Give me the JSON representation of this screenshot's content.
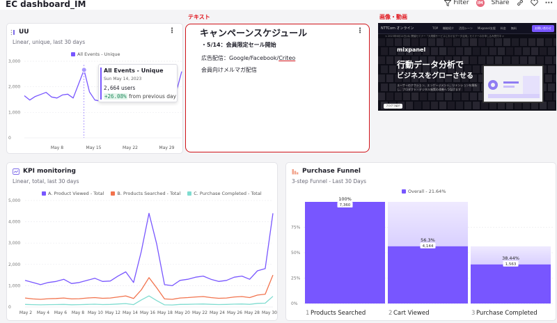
{
  "header": {
    "title": "EC dashboard_IM",
    "filter_label": "Filter",
    "avatar_initials": "IM",
    "share_label": "Share"
  },
  "annotations": {
    "text_label": "テキスト",
    "image_label": "画像・動画"
  },
  "uu_card": {
    "title": "UU",
    "subtitle": "Linear, unique, last 30 days",
    "legend": "All Events - Unique",
    "tooltip": {
      "title": "All Events - Unique",
      "date": "Sun May 14, 2023",
      "value": "2,664",
      "unit": "users",
      "change": "+26.08%",
      "change_suffix": "from previous day"
    }
  },
  "text_card": {
    "heading": "キャンペーンスケジュール",
    "line1": "・5/14：会員限定セール開始",
    "line2_prefix": "広告配信：Google/Facebook/",
    "line2_link": "Criteo",
    "line3": "会員向けメルマガ配信"
  },
  "banner": {
    "logo_text": "NTTCom オンライン",
    "nav_links": [
      "TOP",
      "機能紹介",
      "活用シーン",
      "Mixpanel支援",
      "料金",
      "無料"
    ],
    "cta": "お問い合わせ",
    "ticker": "< 2023年6月14日(水) 開催セミナー「大規模サービスにおけるデータ活用」セミナーのお申し込み受付中 >",
    "brand": "mixpanel",
    "headline1": "行動データ分析で",
    "headline2": "ビジネスをグローさせる",
    "body": "ユーザーのアクション、エンゲージメント、リテンションを解析し、プロダクト・デジタル施策の改善へつなげます",
    "chip": "ブログで紹介"
  },
  "kpi_card": {
    "title": "KPI monitoring",
    "subtitle": "Linear, total, last 30 days",
    "legend": [
      "A. Product Viewed - Total",
      "B. Products Searched - Total",
      "C. Purchase Completed - Total"
    ]
  },
  "funnel_card": {
    "title": "Purchase Funnel",
    "subtitle": "3-step Funnel - Last 30 Days",
    "legend": "Overall - 21.64%"
  },
  "chart_data": [
    {
      "type": "line",
      "title": "UU",
      "x_ticks": [
        "May 8",
        "May 15",
        "May 22",
        "May 29"
      ],
      "y_ticks": [
        "0",
        "1,000",
        "2,000",
        "3,000"
      ],
      "ylim": [
        0,
        3000
      ],
      "series": [
        {
          "name": "All Events - Unique",
          "color": "#7856ff",
          "values": [
            1650,
            1480,
            1620,
            1700,
            1780,
            1600,
            1560,
            1680,
            1710,
            1560,
            2112,
            2664,
            1800,
            1480,
            1440,
            1690,
            1620,
            1590,
            1600,
            1610,
            1580,
            1650,
            1620,
            1600,
            1620,
            1650,
            1560,
            1650,
            1800,
            2600
          ]
        }
      ]
    },
    {
      "type": "line",
      "title": "KPI monitoring",
      "x_ticks": [
        "May 2",
        "May 4",
        "May 6",
        "May 8",
        "May 10",
        "May 12",
        "May 14",
        "May 16",
        "May 18",
        "May 20",
        "May 22",
        "May 24",
        "May 26",
        "May 28",
        "May 30"
      ],
      "y_ticks": [
        "0",
        "1,000",
        "2,000",
        "3,000",
        "4,000",
        "5,000"
      ],
      "ylim": [
        0,
        5000
      ],
      "series": [
        {
          "name": "A. Product Viewed - Total",
          "color": "#7856ff",
          "values": [
            1250,
            1150,
            1050,
            1150,
            1200,
            1300,
            1100,
            1150,
            1250,
            1350,
            1200,
            1220,
            1450,
            1650,
            1150,
            2600,
            4400,
            2950,
            1050,
            1000,
            1250,
            1300,
            1400,
            1450,
            1300,
            1200,
            1250,
            1400,
            1450,
            1300,
            1700,
            1800,
            4400
          ]
        },
        {
          "name": "B. Products Searched - Total",
          "color": "#f2734d",
          "values": [
            420,
            380,
            360,
            390,
            400,
            420,
            380,
            390,
            420,
            440,
            410,
            420,
            470,
            520,
            400,
            800,
            1380,
            900,
            380,
            360,
            420,
            440,
            470,
            490,
            440,
            410,
            420,
            470,
            490,
            440,
            560,
            600,
            1500
          ]
        },
        {
          "name": "C. Purchase Completed - Total",
          "color": "#7fdcd0",
          "values": [
            120,
            110,
            100,
            110,
            115,
            120,
            105,
            110,
            120,
            130,
            115,
            120,
            140,
            160,
            110,
            330,
            520,
            300,
            100,
            95,
            120,
            125,
            135,
            140,
            125,
            115,
            120,
            135,
            140,
            125,
            170,
            180,
            500
          ]
        }
      ]
    },
    {
      "type": "bar",
      "title": "Purchase Funnel",
      "y_ticks": [
        "0%",
        "25%",
        "50%",
        "75%"
      ],
      "ylim": [
        0,
        100
      ],
      "categories": [
        "Products Searched",
        "Cart Viewed",
        "Purchase Completed"
      ],
      "step_numbers": [
        "1",
        "2",
        "3"
      ],
      "values": [
        100,
        56.3,
        38.44
      ],
      "value_labels": [
        "100%",
        "56.3%",
        "38.44%"
      ],
      "counts": [
        "7,360",
        "4,144",
        "1,563"
      ],
      "colors": {
        "bar": "#7856ff",
        "dropoff_top": "#efeaff",
        "dropoff_bottom": "#d9d0ff"
      }
    }
  ]
}
